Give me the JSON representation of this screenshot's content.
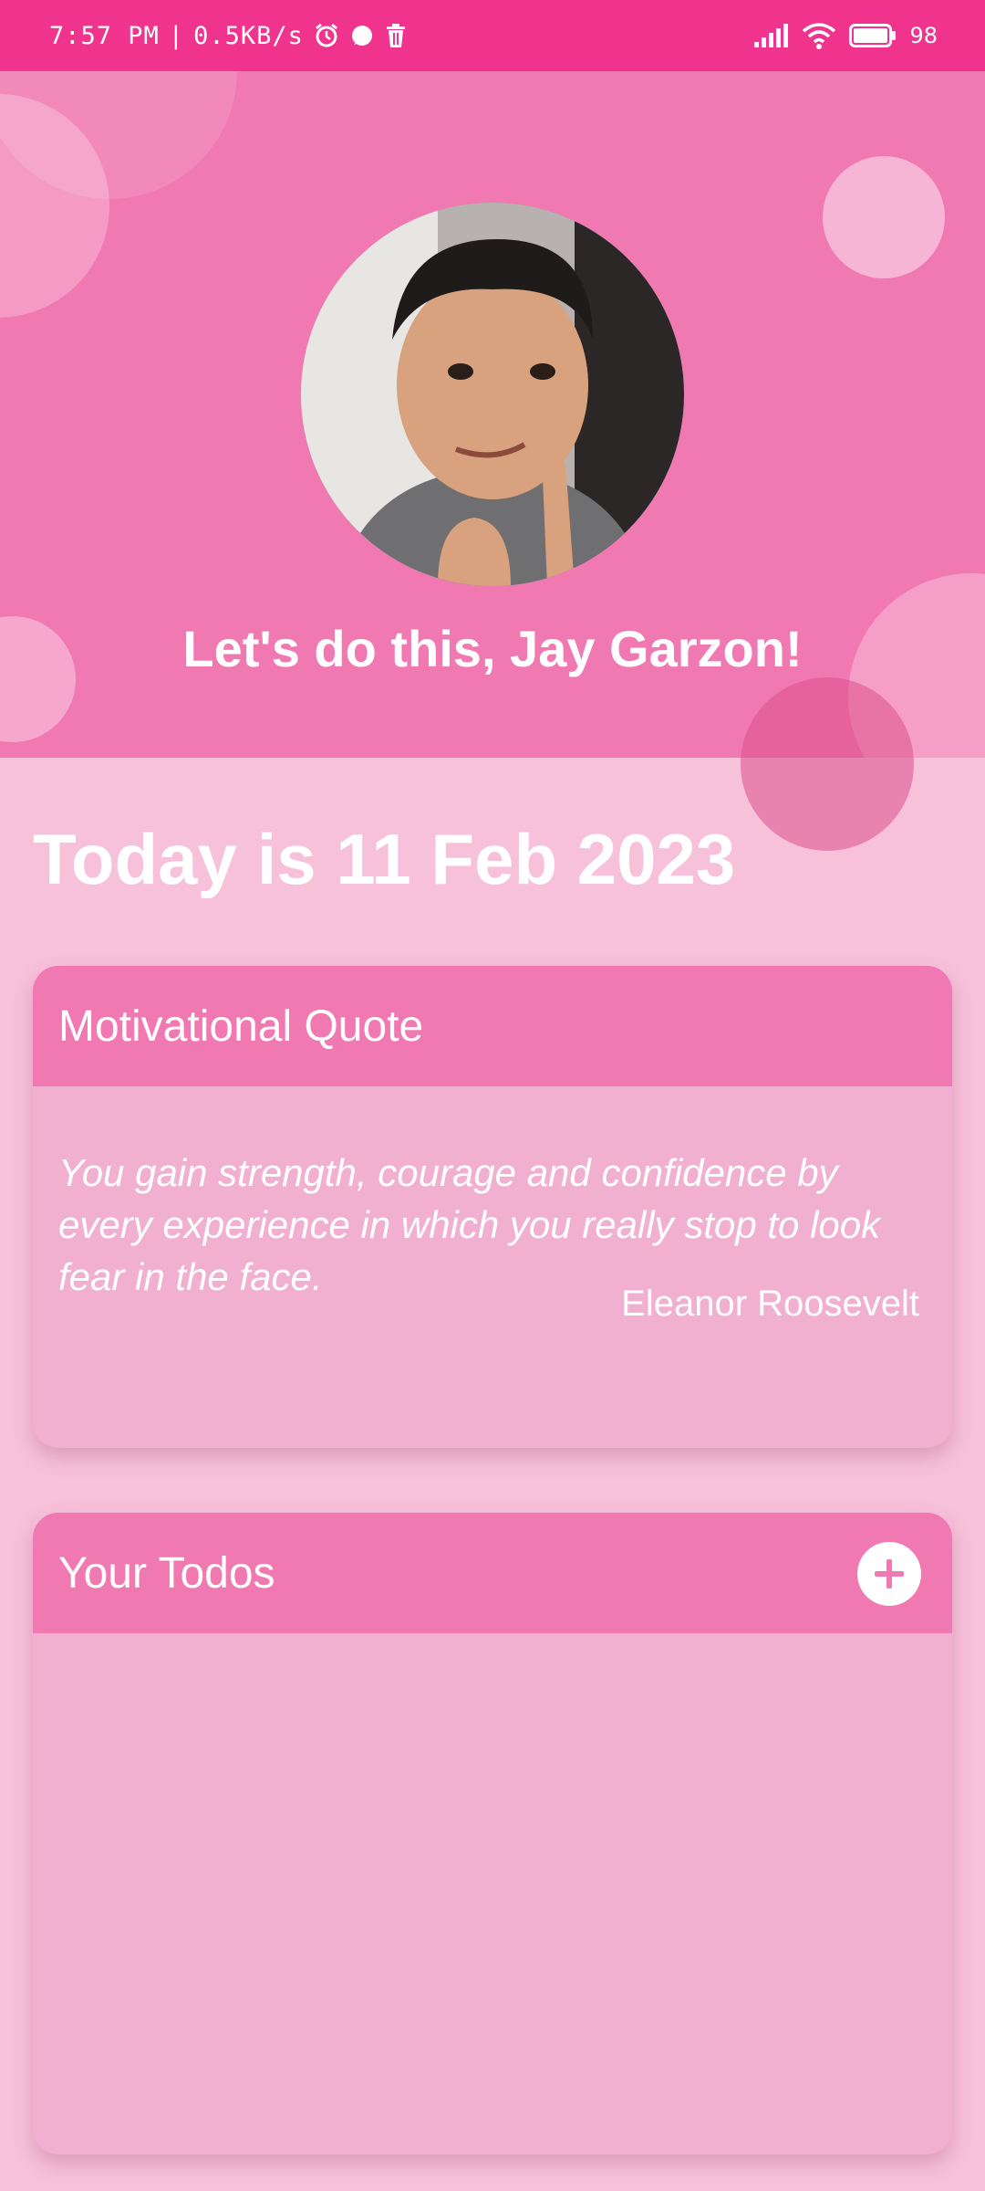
{
  "status_bar": {
    "time": "7:57 PM",
    "separator": "|",
    "net_speed": "0.5KB/s",
    "battery": "98",
    "icons": [
      "alarm-icon",
      "chat-icon",
      "trash-icon",
      "signal-icon",
      "wifi-icon",
      "battery-icon"
    ]
  },
  "header": {
    "greeting": "Let's do this, Jay Garzon!"
  },
  "date_line": "Today is 11 Feb 2023",
  "quote_card": {
    "title": "Motivational Quote",
    "quote": "You gain strength, courage and confidence by every experience in which you really stop to look fear in the face.",
    "author": "Eleanor Roosevelt"
  },
  "todos_card": {
    "title": "Your Todos",
    "add_icon": "plus-icon"
  },
  "colors": {
    "status_bar": "#f0338d",
    "header": "#f179b2",
    "background": "#f7c1da",
    "card_body": "#f2b0d1",
    "card_header": "#f179b2"
  }
}
